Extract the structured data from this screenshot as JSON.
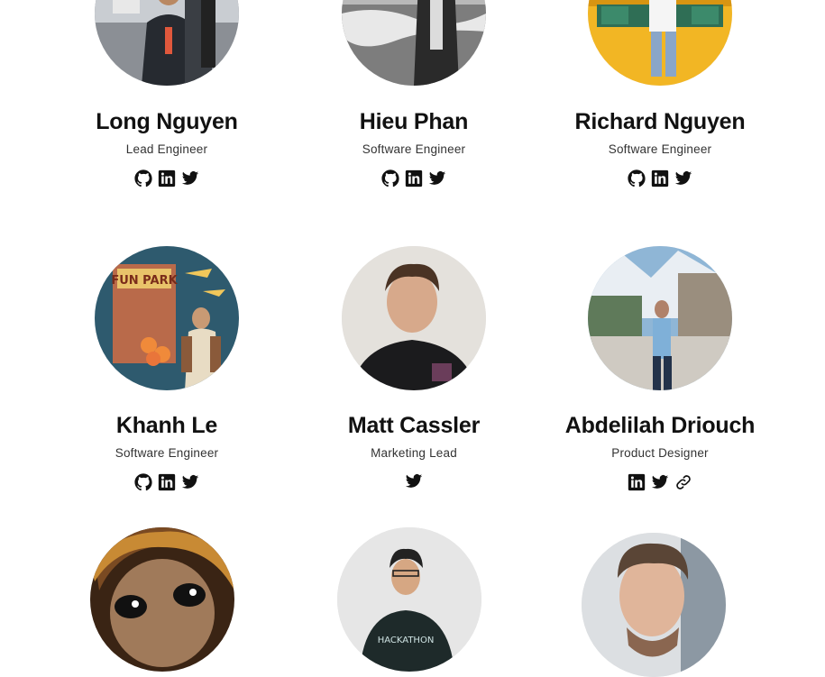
{
  "team": [
    {
      "name": "Long Nguyen",
      "role": "Lead Engineer",
      "socials": [
        "github",
        "linkedin",
        "twitter"
      ]
    },
    {
      "name": "Hieu Phan",
      "role": "Software Engineer",
      "socials": [
        "github",
        "linkedin",
        "twitter"
      ]
    },
    {
      "name": "Richard Nguyen",
      "role": "Software Engineer",
      "socials": [
        "github",
        "linkedin",
        "twitter"
      ]
    },
    {
      "name": "Khanh Le",
      "role": "Software Engineer",
      "socials": [
        "github",
        "linkedin",
        "twitter"
      ]
    },
    {
      "name": "Matt Cassler",
      "role": "Marketing Lead",
      "socials": [
        "twitter"
      ]
    },
    {
      "name": "Abdelilah Driouch",
      "role": "Product Designer",
      "socials": [
        "linkedin",
        "twitter",
        "link"
      ]
    },
    {
      "name": "",
      "role": "",
      "socials": []
    },
    {
      "name": "",
      "role": "",
      "socials": []
    },
    {
      "name": "",
      "role": "",
      "socials": []
    }
  ],
  "icons": {
    "github": "github-icon",
    "linkedin": "linkedin-icon",
    "twitter": "twitter-icon",
    "link": "link-icon"
  }
}
